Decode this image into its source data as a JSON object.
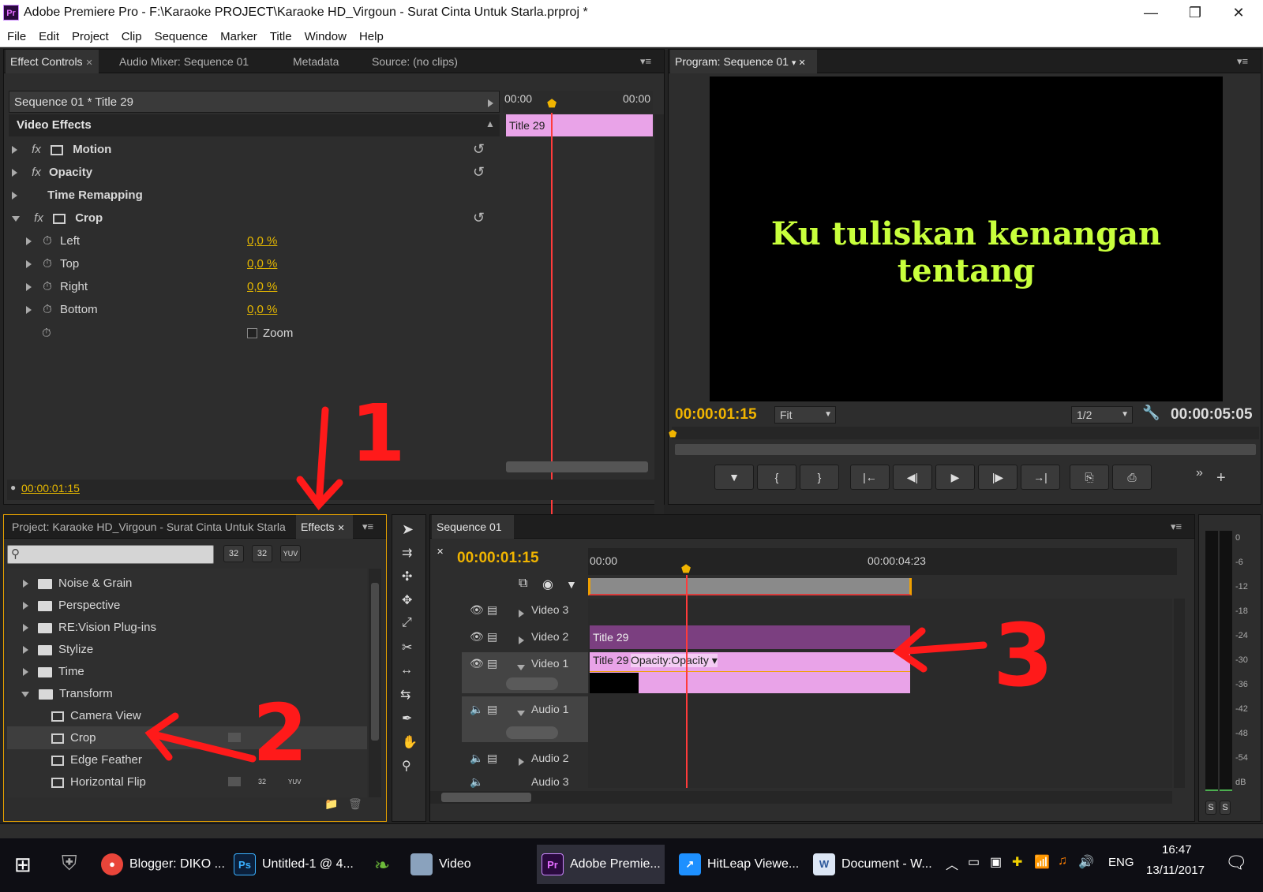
{
  "window": {
    "title": "Adobe Premiere Pro - F:\\Karaoke PROJECT\\Karaoke HD_Virgoun - Surat Cinta Untuk Starla.prproj *",
    "app_icon": "Pr",
    "minimize": "—",
    "maximize": "❐",
    "close": "✕"
  },
  "menu": [
    "File",
    "Edit",
    "Project",
    "Clip",
    "Sequence",
    "Marker",
    "Title",
    "Window",
    "Help"
  ],
  "effect_controls": {
    "tabs": [
      "Effect Controls",
      "Audio Mixer: Sequence 01",
      "Metadata",
      "Source: (no clips)"
    ],
    "clip_path": "Sequence 01 * Title 29",
    "ruler_start": "00:00",
    "ruler_end": "00:00",
    "clip_label": "Title 29",
    "section": "Video Effects",
    "effects": [
      {
        "name": "Motion",
        "fx": "fx"
      },
      {
        "name": "Opacity",
        "fx": "fx"
      },
      {
        "name": "Time Remapping",
        "fx": ""
      },
      {
        "name": "Crop",
        "fx": "fx"
      }
    ],
    "params": [
      {
        "name": "Left",
        "value": "0,0 %"
      },
      {
        "name": "Top",
        "value": "0,0 %"
      },
      {
        "name": "Right",
        "value": "0,0 %"
      },
      {
        "name": "Bottom",
        "value": "0,0 %"
      }
    ],
    "zoom_label": "Zoom",
    "timecode": "00:00:01:15"
  },
  "program_monitor": {
    "tab": "Program: Sequence 01",
    "caption": "Ku tuliskan kenangan tentang",
    "timecode": "00:00:01:15",
    "fit": "Fit",
    "resolution": "1/2",
    "duration": "00:00:05:05",
    "transport": [
      "▼",
      "{",
      "}",
      "|←",
      "◀|",
      "▶",
      "|▶",
      "→|",
      "⎘",
      "⎙"
    ]
  },
  "project_panel": {
    "tabs": [
      "Project: Karaoke HD_Virgoun - Surat Cinta Untuk Starla",
      "Effects"
    ],
    "search_placeholder": "",
    "filter_icons": [
      "32",
      "32",
      "YUV"
    ],
    "folders": [
      "Noise & Grain",
      "Perspective",
      "RE:Vision Plug-ins",
      "Stylize",
      "Time",
      "Transform"
    ],
    "transform_items": [
      "Camera View",
      "Crop",
      "Edge Feather",
      "Horizontal Flip"
    ],
    "item_badges": [
      "32",
      "YUV"
    ]
  },
  "timeline": {
    "tab": "Sequence 01",
    "timecode": "00:00:01:15",
    "ruler_start": "00:00",
    "ruler_mid": "00:00:04:23",
    "tracks": [
      {
        "name": "Video 3",
        "kind": "video",
        "expanded": false
      },
      {
        "name": "Video 2",
        "kind": "video",
        "expanded": false
      },
      {
        "name": "Video 1",
        "kind": "video",
        "expanded": true
      },
      {
        "name": "Audio 1",
        "kind": "audio",
        "expanded": true
      },
      {
        "name": "Audio 2",
        "kind": "audio",
        "expanded": false
      },
      {
        "name": "Audio 3",
        "kind": "audio",
        "expanded": false
      }
    ],
    "clip_v2": "Title 29",
    "clip_v1": "Title 29",
    "clip_v1_fx": "Opacity:Opacity ▾"
  },
  "audio_meter": {
    "scale": [
      "0",
      "-6",
      "-12",
      "-18",
      "-24",
      "-30",
      "-36",
      "-42",
      "-48",
      "-54",
      "dB"
    ],
    "solo": [
      "S",
      "S"
    ]
  },
  "annotations": [
    "1",
    "2",
    "3"
  ],
  "taskbar": {
    "items": [
      {
        "label": "Blogger: DIKO ...",
        "icon": "chrome-icon"
      },
      {
        "label": "Untitled-1 @ 4...",
        "icon": "photoshop-icon"
      },
      {
        "label": "Video",
        "icon": "folder-icon"
      },
      {
        "label": "Adobe Premie...",
        "icon": "premiere-icon"
      },
      {
        "label": "HitLeap Viewe...",
        "icon": "hitleap-icon"
      },
      {
        "label": "Document - W...",
        "icon": "document-icon"
      }
    ],
    "lang": "ENG",
    "time": "16:47",
    "date": "13/11/2017"
  },
  "colors": {
    "accent": "#f0b400",
    "clip_pink": "#e9a3e8",
    "clip_purple": "#7b3f80",
    "playhead": "#ff3b3b",
    "caption": "#c8ff3c"
  }
}
